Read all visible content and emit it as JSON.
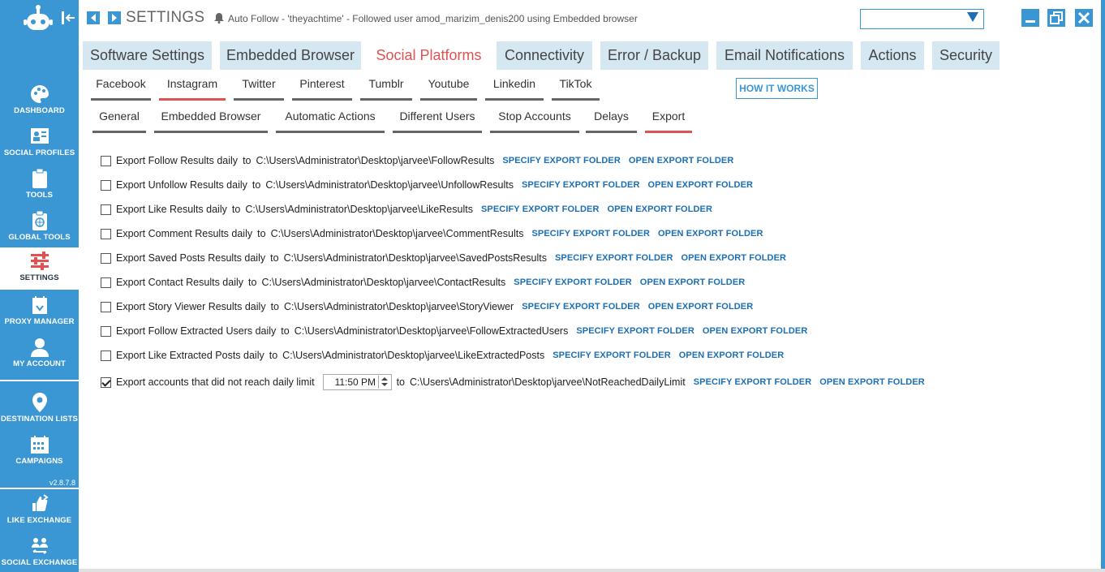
{
  "app": {
    "title": "SETTINGS",
    "status_text": "Auto Follow - 'theyachtime' - Followed user amod_marizim_denis200 using Embedded browser",
    "version": "v2.8.7.8",
    "accent": "#3b97d3",
    "active_red": "#e05252",
    "link_blue": "#1c6fb4"
  },
  "sidebar": {
    "items": [
      {
        "label": "DASHBOARD",
        "icon": "palette-icon"
      },
      {
        "label": "SOCIAL PROFILES",
        "icon": "profiles-icon"
      },
      {
        "label": "TOOLS",
        "icon": "clipboard-icon"
      },
      {
        "label": "GLOBAL TOOLS",
        "icon": "globe-clipboard-icon"
      },
      {
        "label": "SETTINGS",
        "icon": "sliders-icon"
      },
      {
        "label": "PROXY MANAGER",
        "icon": "proxy-icon"
      },
      {
        "label": "MY ACCOUNT",
        "icon": "user-icon"
      },
      {
        "label": "DESTINATION LISTS",
        "icon": "map-pin-icon"
      },
      {
        "label": "CAMPAIGNS",
        "icon": "calendar-icon"
      },
      {
        "label": "LIKE EXCHANGE",
        "icon": "like-exchange-icon"
      },
      {
        "label": "SOCIAL EXCHANGE",
        "icon": "social-exchange-icon"
      }
    ]
  },
  "top_tabs": [
    {
      "label": "Software Settings"
    },
    {
      "label": "Embedded Browser"
    },
    {
      "label": "Social Platforms"
    },
    {
      "label": "Connectivity"
    },
    {
      "label": "Error / Backup"
    },
    {
      "label": "Email Notifications"
    },
    {
      "label": "Actions"
    },
    {
      "label": "Security"
    }
  ],
  "platform_tabs": [
    {
      "label": "Facebook"
    },
    {
      "label": "Instagram"
    },
    {
      "label": "Twitter"
    },
    {
      "label": "Pinterest"
    },
    {
      "label": "Tumblr"
    },
    {
      "label": "Youtube"
    },
    {
      "label": "Linkedin"
    },
    {
      "label": "TikTok"
    }
  ],
  "how_it_works": "HOW IT WORKS",
  "sub_tabs": [
    {
      "label": "General"
    },
    {
      "label": "Embedded Browser"
    },
    {
      "label": "Automatic Actions"
    },
    {
      "label": "Different Users"
    },
    {
      "label": "Stop Accounts"
    },
    {
      "label": "Delays"
    },
    {
      "label": "Export"
    }
  ],
  "links": {
    "specify": "SPECIFY EXPORT FOLDER",
    "open": "OPEN EXPORT FOLDER"
  },
  "export_rows": [
    {
      "text": "Export Follow Results daily",
      "to": "to",
      "path": "C:\\Users\\Administrator\\Desktop\\jarvee\\FollowResults",
      "checked": false
    },
    {
      "text": "Export Unfollow Results daily",
      "to": "to",
      "path": "C:\\Users\\Administrator\\Desktop\\jarvee\\UnfollowResults",
      "checked": false
    },
    {
      "text": "Export Like Results daily",
      "to": "to",
      "path": "C:\\Users\\Administrator\\Desktop\\jarvee\\LikeResults",
      "checked": false
    },
    {
      "text": "Export Comment Results daily",
      "to": "to",
      "path": "C:\\Users\\Administrator\\Desktop\\jarvee\\CommentResults",
      "checked": false
    },
    {
      "text": "Export Saved Posts Results daily",
      "to": "to",
      "path": "C:\\Users\\Administrator\\Desktop\\jarvee\\SavedPostsResults",
      "checked": false
    },
    {
      "text": "Export Contact Results daily",
      "to": "to",
      "path": "C:\\Users\\Administrator\\Desktop\\jarvee\\ContactResults",
      "checked": false
    },
    {
      "text": "Export Story Viewer Results daily",
      "to": "to",
      "path": "C:\\Users\\Administrator\\Desktop\\jarvee\\StoryViewer",
      "checked": false
    },
    {
      "text": "Export Follow Extracted Users daily",
      "to": "to",
      "path": "C:\\Users\\Administrator\\Desktop\\jarvee\\FollowExtractedUsers",
      "checked": false
    },
    {
      "text": "Export Like Extracted Posts daily",
      "to": "to",
      "path": "C:\\Users\\Administrator\\Desktop\\jarvee\\LikeExtractedPosts",
      "checked": false
    },
    {
      "text": "Export accounts that did not reach daily limit",
      "time": "11:50 PM",
      "to": "to",
      "path": "C:\\Users\\Administrator\\Desktop\\jarvee\\NotReachedDailyLimit",
      "checked": true
    }
  ]
}
